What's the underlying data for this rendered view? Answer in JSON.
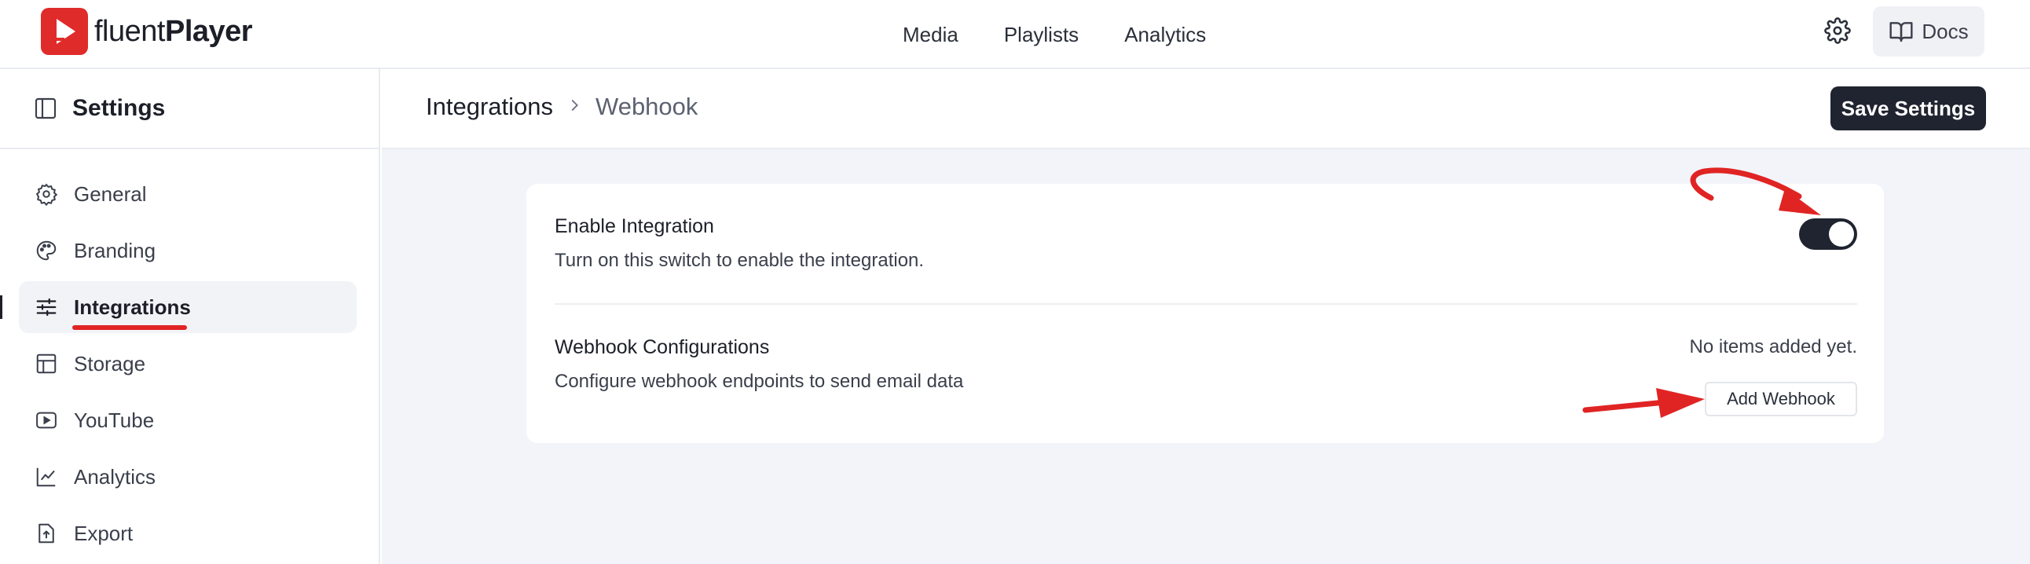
{
  "app": {
    "logo_text_light": "fluent",
    "logo_text_bold": "Player",
    "brand_color": "#e02b2b"
  },
  "topnav": {
    "items": [
      {
        "label": "Media"
      },
      {
        "label": "Playlists"
      },
      {
        "label": "Analytics"
      }
    ],
    "docs_label": "Docs",
    "settings_icon": "gear-icon",
    "docs_icon": "book-icon"
  },
  "sidebar": {
    "title": "Settings",
    "toggle_icon": "sidebar-panel-icon",
    "items": [
      {
        "label": "General",
        "icon": "gear-icon",
        "active": false
      },
      {
        "label": "Branding",
        "icon": "palette-icon",
        "active": false
      },
      {
        "label": "Integrations",
        "icon": "sliders-icon",
        "active": true
      },
      {
        "label": "Storage",
        "icon": "storage-icon",
        "active": false
      },
      {
        "label": "YouTube",
        "icon": "youtube-icon",
        "active": false
      },
      {
        "label": "Analytics",
        "icon": "chart-icon",
        "active": false
      },
      {
        "label": "Export",
        "icon": "export-icon",
        "active": false
      }
    ]
  },
  "header": {
    "breadcrumb_root": "Integrations",
    "breadcrumb_current": "Webhook",
    "save_label": "Save Settings"
  },
  "card": {
    "enable_title": "Enable Integration",
    "enable_desc": "Turn on this switch to enable the integration.",
    "enable_on": true,
    "webhook_title": "Webhook Configurations",
    "webhook_desc": "Configure webhook endpoints to send email data",
    "empty_text": "No items added yet.",
    "add_label": "Add Webhook"
  },
  "colors": {
    "accent_dark": "#1f2430",
    "annotation_red": "#e02424",
    "content_bg": "#f3f4fa"
  }
}
